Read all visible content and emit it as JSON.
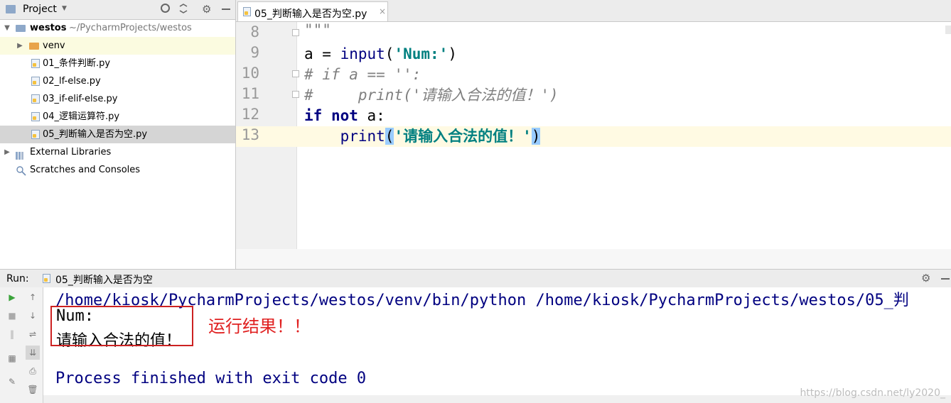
{
  "project_panel": {
    "title": "Project",
    "dropdown_glyph": "▼",
    "header_icons": [
      "target-icon",
      "collapse-icon",
      "gear-icon",
      "hide-icon"
    ],
    "tree": [
      {
        "name": "westos",
        "path": "~/PycharmProjects/westos",
        "type": "project-root",
        "expanded": true
      },
      {
        "name": "venv",
        "type": "folder",
        "expanded": false
      },
      {
        "name": "01_条件判断.py",
        "type": "py-file"
      },
      {
        "name": "02_lf-else.py",
        "type": "py-file"
      },
      {
        "name": "03_if-elif-else.py",
        "type": "py-file"
      },
      {
        "name": "04_逻辑运算符.py",
        "type": "py-file"
      },
      {
        "name": "05_判断输入是否为空.py",
        "type": "py-file",
        "selected": true
      },
      {
        "name": "External Libraries",
        "type": "library",
        "expanded": false
      },
      {
        "name": "Scratches and Consoles",
        "type": "scratches"
      }
    ]
  },
  "editor": {
    "tab_label": "05_判断输入是否为空.py",
    "tab_close": "×",
    "line_numbers": [
      "8",
      "9",
      "10",
      "11",
      "12",
      "13"
    ],
    "code": {
      "l8": "\"\"\"",
      "l9_var": "a = ",
      "l9_fn": "input",
      "l9_open": "(",
      "l9_str": "'Num:'",
      "l9_close": ")",
      "l10": "# if a == '':",
      "l11": "#     print('请输入合法的值！')",
      "l12_if": "if",
      "l12_not": "not",
      "l12_rest": " a:",
      "l13_indent": "    ",
      "l13_fn": "print",
      "l13_open": "(",
      "l13_str": "'请输入合法的值！'",
      "l13_close": ")"
    }
  },
  "run_panel": {
    "label": "Run:",
    "tab_label": "05_判断输入是否为空",
    "output": {
      "command": "/home/kiosk/PycharmProjects/westos/venv/bin/python /home/kiosk/PycharmProjects/westos/05_判",
      "prompt": "Num:",
      "result": "请输入合法的值！",
      "exit": "Process finished with exit code 0"
    },
    "annotation": "运行结果！！"
  },
  "watermark": "https://blog.csdn.net/ly2020_",
  "colors": {
    "keyword": "#000080",
    "string": "#008080",
    "comment": "#808080",
    "annotation_red": "#e02020",
    "current_line": "#fffae3"
  }
}
